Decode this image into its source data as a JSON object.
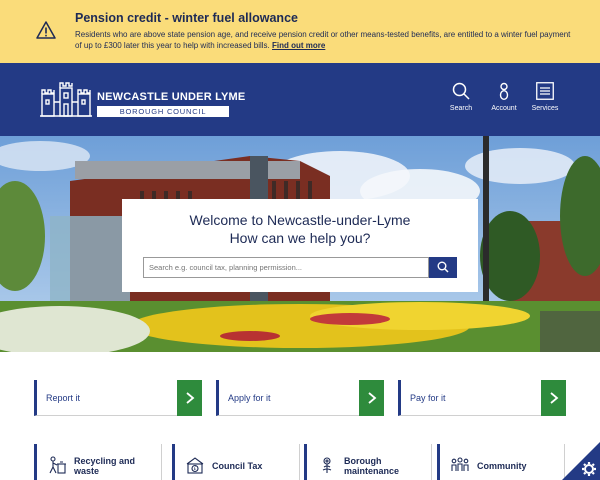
{
  "alert": {
    "title": "Pension credit - winter fuel allowance",
    "text": "Residents who are above state pension age, and receive pension credit or other means-tested benefits, are entitled to a winter fuel payment of up to £300 later this year to help with increased bills.",
    "link": "Find out more",
    "icon": "warning-icon"
  },
  "header": {
    "logo_name": "NEWCASTLE UNDER LYME",
    "logo_sub": "BOROUGH COUNCIL",
    "nav": [
      {
        "label": "Search",
        "icon": "search-icon"
      },
      {
        "label": "Account",
        "icon": "account-icon"
      },
      {
        "label": "Services",
        "icon": "menu-icon"
      }
    ]
  },
  "hero": {
    "title": "Welcome to Newcastle-under-Lyme",
    "subtitle": "How can we help you?",
    "search_placeholder": "Search e.g. council tax, planning permission..."
  },
  "quick_links": [
    {
      "label": "Report it"
    },
    {
      "label": "Apply for it"
    },
    {
      "label": "Pay for it"
    }
  ],
  "tiles": [
    {
      "line1": "Recycling and",
      "line2": "waste",
      "icon": "recycling-icon"
    },
    {
      "line1": "Council Tax",
      "line2": "",
      "icon": "council-tax-icon"
    },
    {
      "line1": "Borough",
      "line2": "maintenance",
      "icon": "maintenance-icon"
    },
    {
      "line1": "Community",
      "line2": "",
      "icon": "community-icon"
    }
  ],
  "colors": {
    "alert_bg": "#fadc7a",
    "brand_blue": "#233a85",
    "arrow_green": "#2e8b3c"
  }
}
